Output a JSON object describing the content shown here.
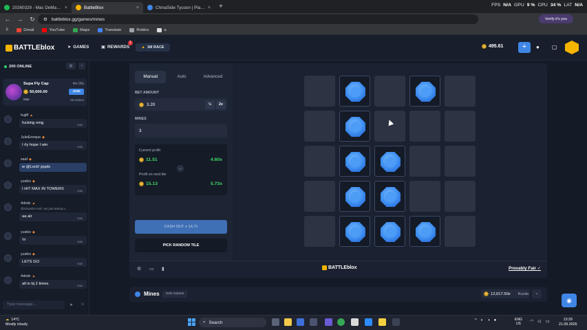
{
  "browser": {
    "tabs": [
      {
        "label": "20260329 - Mac DeMarco",
        "color": "#1db954",
        "active": false
      },
      {
        "label": "BattleBlox",
        "color": "#f5b400",
        "active": true
      },
      {
        "label": "ChinaSide Tycoon | Play on Robl",
        "color": "#3f86e6",
        "active": false
      }
    ],
    "perf": {
      "fps_label": "FPS",
      "fps": "N/A",
      "gpu_label": "GPU",
      "gpu": "9 %",
      "cpu_label": "CPU",
      "cpu": "34 %",
      "lat_label": "LAT",
      "lat": "N/A"
    },
    "url": "battleblox.gg/games/mines",
    "verify": "Verify it's you",
    "bookmarks": [
      "Gmail",
      "YouTube",
      "Maps",
      "Translate",
      "Roblox",
      "a"
    ]
  },
  "header": {
    "logo": "BATTLEblox",
    "nav": {
      "games": "GAMES",
      "rewards": "REWARDS",
      "rewards_badge": "1",
      "race": "1M RACE"
    },
    "balance": "495.61"
  },
  "sidebar": {
    "online": "200 ONLINE",
    "promo": {
      "title": "Supa Fly Cap",
      "timer": "4m 00s",
      "amount": "50,000.00",
      "join": "JOIN",
      "user": "Nite",
      "entries": "96 entries"
    },
    "messages": [
      {
        "name": "hujiff",
        "text": "fucking omg",
        "time": "now",
        "reply": ""
      },
      {
        "name": "JulioEnrique",
        "text": "I rly hope I win",
        "time": "now",
        "reply": ""
      },
      {
        "name": "saaf",
        "text": "w @Lock! pppls",
        "time": "now",
        "reply": "",
        "highlight": true
      },
      {
        "name": "yusiko",
        "text": "I HIT MAX IN TOWERS",
        "time": "now",
        "reply": ""
      },
      {
        "name": "4dndv",
        "text": "aa alr",
        "time": "now",
        "reply": "@N3ssxllet nah i am just testing s..."
      },
      {
        "name": "yusiko",
        "text": "!rr",
        "time": "now",
        "reply": ""
      },
      {
        "name": "yusiko",
        "text": "LETS GO",
        "time": "now",
        "reply": ""
      },
      {
        "name": "4dndv",
        "text": "all in bj 2 times",
        "time": "now",
        "reply": ""
      }
    ],
    "input_placeholder": "Type message..."
  },
  "game": {
    "tabs": [
      "Manual",
      "Auto",
      "Advanced"
    ],
    "bet_label": "BET AMOUNT",
    "bet_value": "3.20",
    "half": "½",
    "double": "2x",
    "mines_label": "MINES",
    "mines_value": "3",
    "current_profit_label": "Current profit",
    "current_profit": "11.51",
    "current_multiplier": "4.60x",
    "next_profit_label": "Profit on next tile",
    "next_profit": "15.13",
    "next_multiplier": "5.73x",
    "cashout": "CASH OUT",
    "cashout_amount": "14.71",
    "pick_random": "PICK RANDOM TILE",
    "footer_logo": "BATTLEblox",
    "provably_fair": "Provably Fair",
    "grid": [
      [
        0,
        1,
        0,
        1,
        0
      ],
      [
        0,
        1,
        0,
        0,
        0
      ],
      [
        0,
        1,
        1,
        0,
        0
      ],
      [
        0,
        1,
        1,
        0,
        0
      ],
      [
        0,
        1,
        1,
        1,
        0
      ]
    ]
  },
  "below": {
    "title": "Mines",
    "tag": "Solo Games",
    "wager": "12,017.50x",
    "wager_unit": "Kurdo"
  },
  "taskbar": {
    "temp": "14°C",
    "weather": "Mostly cloudy",
    "search": "Search",
    "lang1": "ENG",
    "lang2": "US",
    "time": "13:29",
    "date": "21.09.2026"
  }
}
